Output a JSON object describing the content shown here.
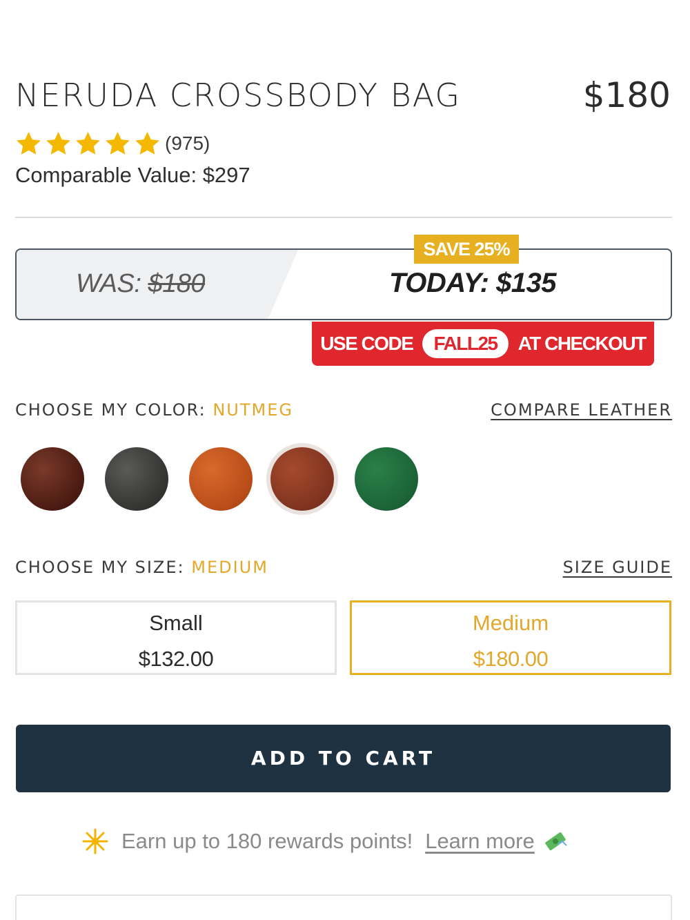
{
  "product": {
    "title": "NERUDA CROSSBODY BAG",
    "price": "$180",
    "rating_stars": 5,
    "review_count": "(975)",
    "comparable_value": "Comparable Value: $297"
  },
  "promo": {
    "was_label": "WAS: ",
    "was_price": "$180",
    "today": "TODAY: $135",
    "save_badge": "SAVE 25%",
    "code_prefix": "USE CODE",
    "code": "FALL25",
    "code_suffix": "AT CHECKOUT"
  },
  "color": {
    "label": "CHOOSE MY COLOR: ",
    "selected": "NUTMEG",
    "compare_link": "COMPARE LEATHER",
    "swatches": [
      {
        "name": "dark-brown",
        "color": "#5a2418"
      },
      {
        "name": "black",
        "color": "#3c3c3a"
      },
      {
        "name": "cognac",
        "color": "#c3541c"
      },
      {
        "name": "nutmeg",
        "color": "#8a3a22",
        "selected": true
      },
      {
        "name": "green",
        "color": "#1e6b3c"
      }
    ]
  },
  "size": {
    "label": "CHOOSE MY SIZE: ",
    "selected": "MEDIUM",
    "guide_link": "SIZE GUIDE",
    "options": [
      {
        "name": "Small",
        "price": "$132.00"
      },
      {
        "name": "Medium",
        "price": "$180.00",
        "selected": true
      }
    ]
  },
  "cart": {
    "add_label": "ADD TO CART"
  },
  "rewards": {
    "text": "Earn up to 180 rewards points!",
    "link": "Learn more"
  },
  "colors": {
    "accent_gold": "#e6b020",
    "promo_red": "#e0272e",
    "button_navy": "#1e3242",
    "star_yellow": "#f5b800"
  }
}
